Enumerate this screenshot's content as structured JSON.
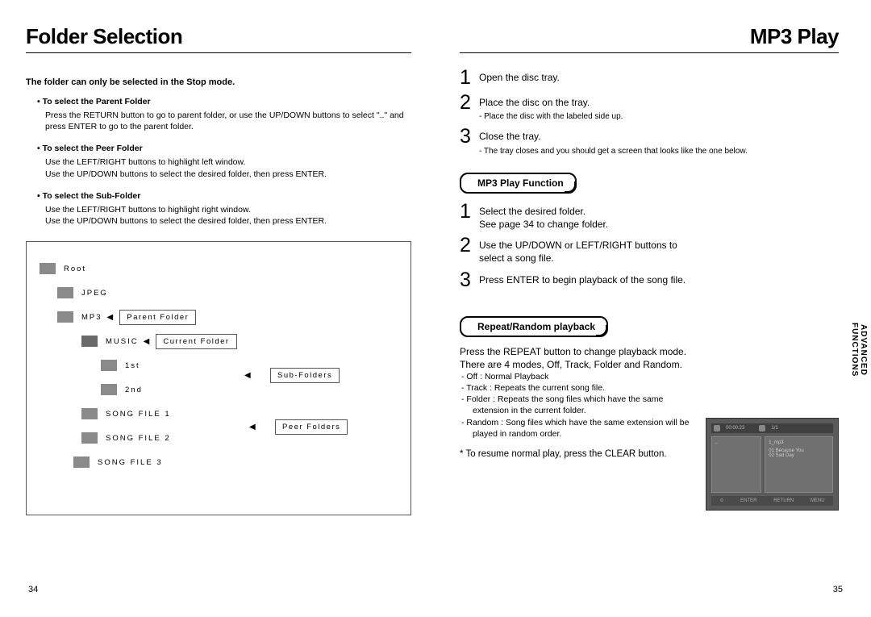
{
  "left": {
    "title": "Folder Selection",
    "intro": "The folder can only be selected in the Stop mode.",
    "bullets": [
      {
        "title": "To select the Parent Folder",
        "body": "Press the RETURN button to go to parent folder, or use the UP/DOWN buttons to select \"..\" and press ENTER to go to the parent folder."
      },
      {
        "title": "To select the Peer Folder",
        "body": "Use the LEFT/RIGHT buttons to highlight left window.\nUse the UP/DOWN buttons to select the desired folder, then press ENTER."
      },
      {
        "title": "To select the Sub-Folder",
        "body": "Use the LEFT/RIGHT buttons to highlight right window.\nUse the UP/DOWN buttons to select the desired folder, then press ENTER."
      }
    ],
    "tree": {
      "root": "Root",
      "jpeg": "JPEG",
      "mp3": "MP3",
      "music": "MUSIC",
      "first": "1st",
      "second": "2nd",
      "song1": "SONG FILE 1",
      "song2": "SONG FILE 2",
      "song3": "SONG FILE 3",
      "parent_label": "Parent Folder",
      "current_label": "Current Folder",
      "sub_label": "Sub-Folders",
      "peer_label": "Peer Folders"
    },
    "page_num": "34"
  },
  "right": {
    "title": "MP3 Play",
    "steps_load": [
      {
        "num": "1",
        "text": "Open the disc tray."
      },
      {
        "num": "2",
        "text": "Place the disc on the tray.",
        "sub": "- Place the disc with the labeled side up."
      },
      {
        "num": "3",
        "text": "Close the tray.",
        "sub": "- The tray closes and you should get a screen that looks like the one below."
      }
    ],
    "pill_play": "MP3 Play Function",
    "steps_play": [
      {
        "num": "1",
        "text": "Select the desired folder.\nSee page 34 to change folder."
      },
      {
        "num": "2",
        "text": "Use the UP/DOWN or LEFT/RIGHT buttons to select a song file."
      },
      {
        "num": "3",
        "text": "Press ENTER to begin playback of the song file."
      }
    ],
    "pill_repeat": "Repeat/Random playback",
    "repeat_intro": "Press the REPEAT button to change playback mode.\nThere are 4 modes, Off, Track, Folder and Random.",
    "repeat_modes": {
      "off": "- Off : Normal Playback",
      "track": "- Track : Repeats the current song file.",
      "folder": "- Folder : Repeats the song files which have the same",
      "folder2": "extension in the current folder.",
      "random": "- Random : Song files which have the same extension will be",
      "random2": "played in random order."
    },
    "resume": "* To resume normal play, press the CLEAR button.",
    "side_tab": "ADVANCED\nFUNCTIONS",
    "page_num": "35",
    "screenshot": {
      "time": "00:00:23",
      "track": "1/1",
      "file": "1_mp3",
      "l1": "..",
      "l2": "",
      "r1": "01 Because You",
      "r2": "02 Sad Day",
      "b1": "ENTER",
      "b2": "RETURN",
      "b3": "MENU"
    }
  }
}
